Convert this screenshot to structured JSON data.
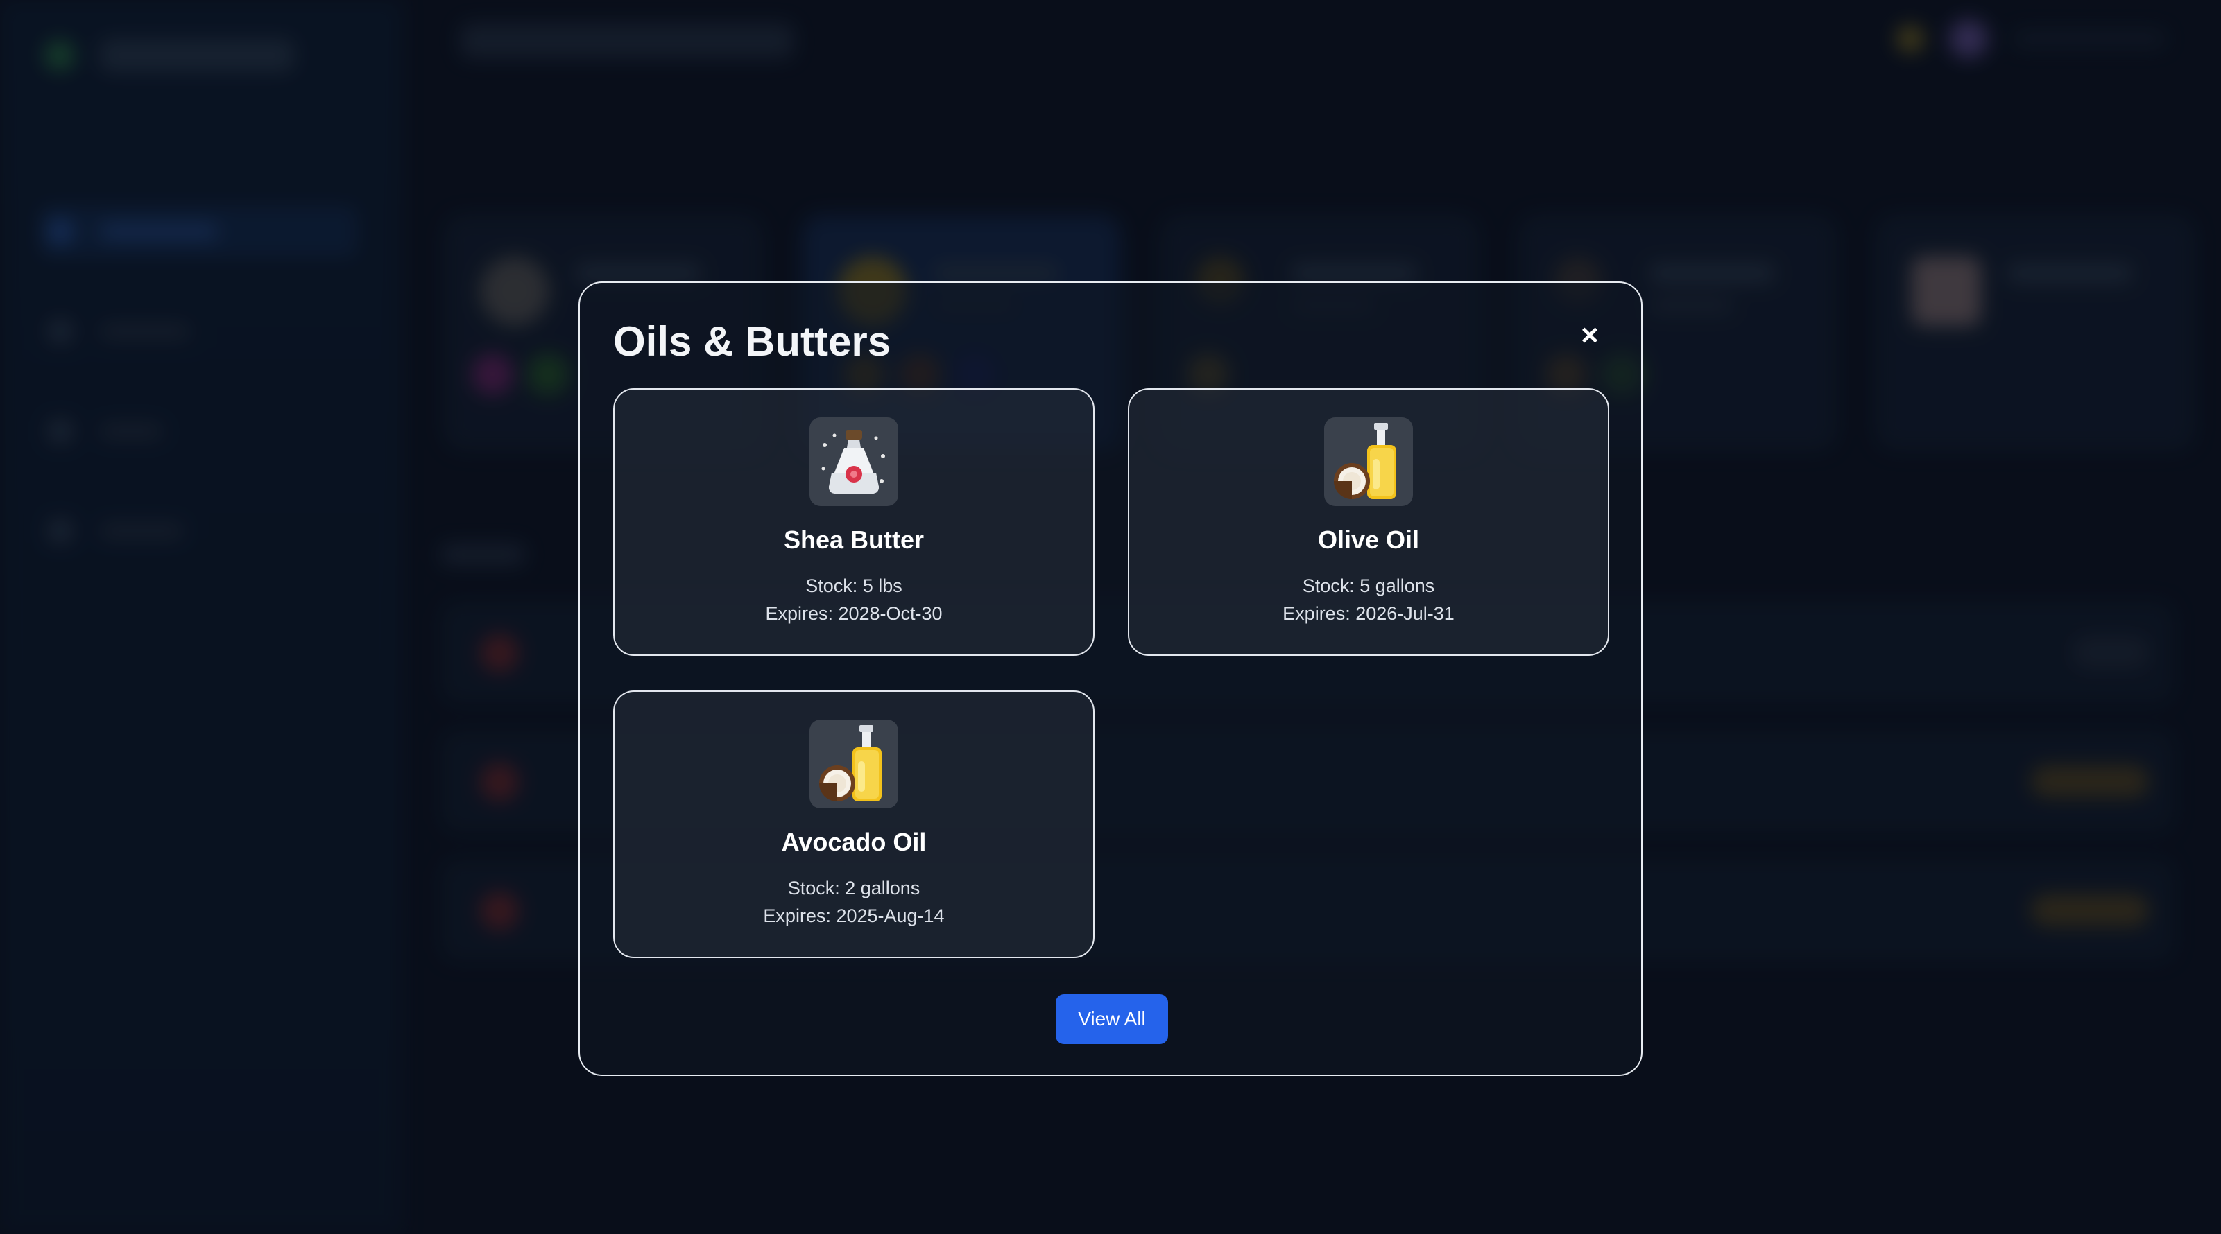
{
  "modal": {
    "title": "Oils & Butters",
    "close_label": "×",
    "view_all_label": "View All"
  },
  "items": [
    {
      "name": "Shea Butter",
      "stock": "Stock: 5 lbs",
      "expires": "Expires: 2028-Oct-30",
      "icon": "perfume-bottle-icon"
    },
    {
      "name": "Olive Oil",
      "stock": "Stock: 5 gallons",
      "expires": "Expires: 2026-Jul-31",
      "icon": "coconut-oil-bottle-icon"
    },
    {
      "name": "Avocado Oil",
      "stock": "Stock: 2 gallons",
      "expires": "Expires: 2025-Aug-14",
      "icon": "coconut-oil-bottle-icon"
    }
  ],
  "colors": {
    "accent": "#2563eb",
    "modal_border": "#e8ecf2",
    "background": "#0b1220"
  }
}
